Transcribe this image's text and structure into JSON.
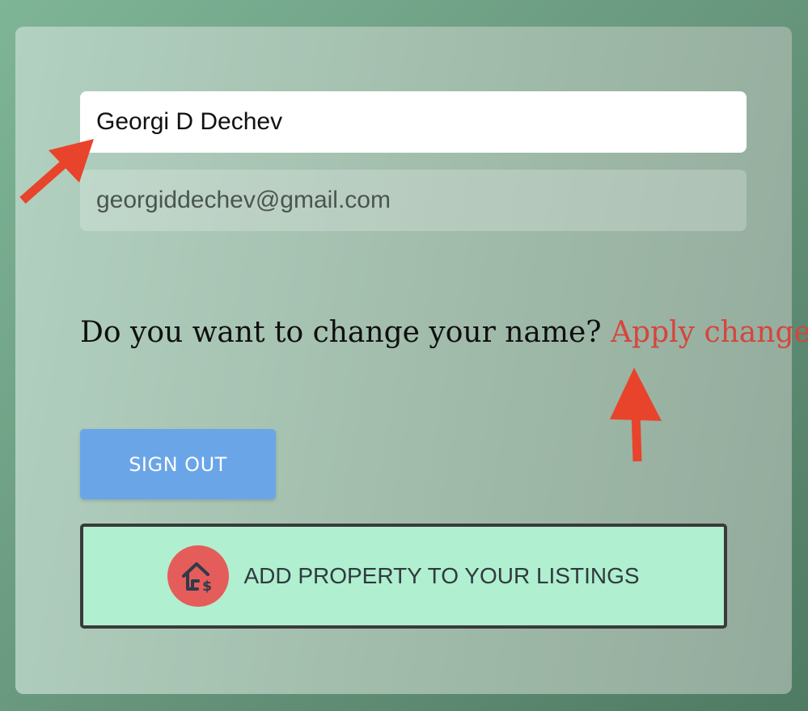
{
  "profile": {
    "name_value": "Georgi D Dechev",
    "email_value": "georgiddechev@gmail.com"
  },
  "prompt": {
    "question": "Do you want to change your name?",
    "apply_link": "Apply changes"
  },
  "actions": {
    "sign_out": "SIGN OUT",
    "add_property": "ADD PROPERTY TO YOUR LISTINGS",
    "add_property_icon": "house-dollar-icon"
  },
  "colors": {
    "apply_link": "#d6453c",
    "sign_out_bg": "#6aa5e8",
    "add_property_bg": "#b0efcf",
    "icon_circle": "#e45d5a",
    "annotation_arrow": "#e8442b"
  }
}
